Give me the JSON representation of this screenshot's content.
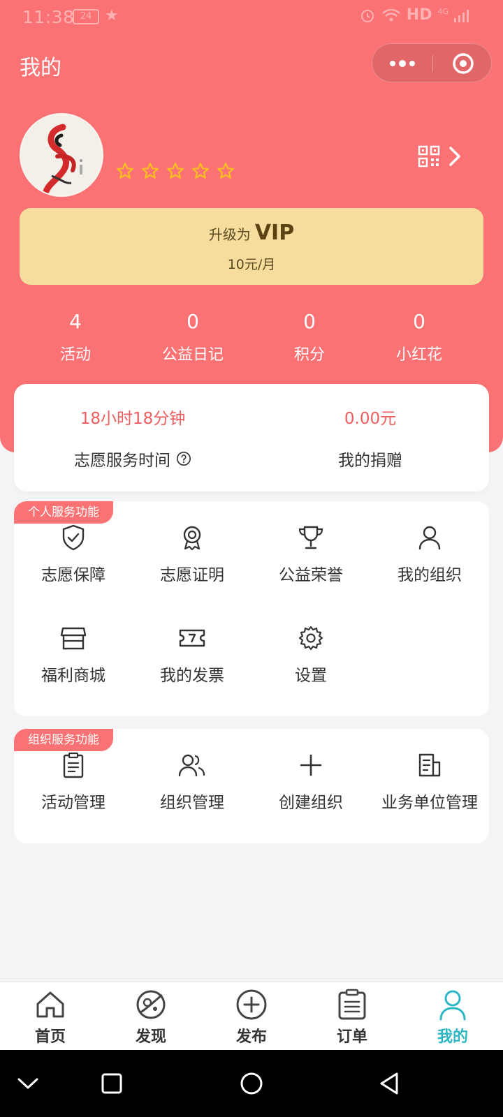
{
  "status": {
    "time": "11:38",
    "badge": "24",
    "hd": "HD",
    "net": "4G"
  },
  "title": "我的",
  "profile": {
    "rating_stars": 5
  },
  "vip": {
    "prefix": "升级为",
    "label": "VIP",
    "price": "10元/月"
  },
  "stats": [
    {
      "value": "4",
      "label": "活动"
    },
    {
      "value": "0",
      "label": "公益日记"
    },
    {
      "value": "0",
      "label": "积分"
    },
    {
      "value": "0",
      "label": "小红花"
    }
  ],
  "service": {
    "time_value": "18小时18分钟",
    "time_label": "志愿服务时间",
    "donation_value": "0.00元",
    "donation_label": "我的捐赠"
  },
  "personal": {
    "tag": "个人服务功能",
    "items": [
      {
        "label": "志愿保障",
        "icon": "shield-check-icon"
      },
      {
        "label": "志愿证明",
        "icon": "badge-icon"
      },
      {
        "label": "公益荣誉",
        "icon": "trophy-icon"
      },
      {
        "label": "我的组织",
        "icon": "user-icon"
      },
      {
        "label": "福利商城",
        "icon": "store-icon"
      },
      {
        "label": "我的发票",
        "icon": "ticket-icon"
      },
      {
        "label": "设置",
        "icon": "gear-icon"
      }
    ]
  },
  "org": {
    "tag": "组织服务功能",
    "items": [
      {
        "label": "活动管理",
        "icon": "clipboard-icon"
      },
      {
        "label": "组织管理",
        "icon": "users-icon"
      },
      {
        "label": "创建组织",
        "icon": "plus-icon"
      },
      {
        "label": "业务单位管理",
        "icon": "document-icon"
      }
    ]
  },
  "tabbar": {
    "items": [
      {
        "label": "首页",
        "icon": "home-icon"
      },
      {
        "label": "发现",
        "icon": "planet-icon"
      },
      {
        "label": "发布",
        "icon": "plus-circle-icon"
      },
      {
        "label": "订单",
        "icon": "list-icon"
      },
      {
        "label": "我的",
        "icon": "person-icon"
      }
    ],
    "active_color": "#2cb7c4"
  },
  "colors": {
    "brand": "#fb7274",
    "vip_bg": "#f6dd9d",
    "value_red": "#ef5d5d"
  }
}
